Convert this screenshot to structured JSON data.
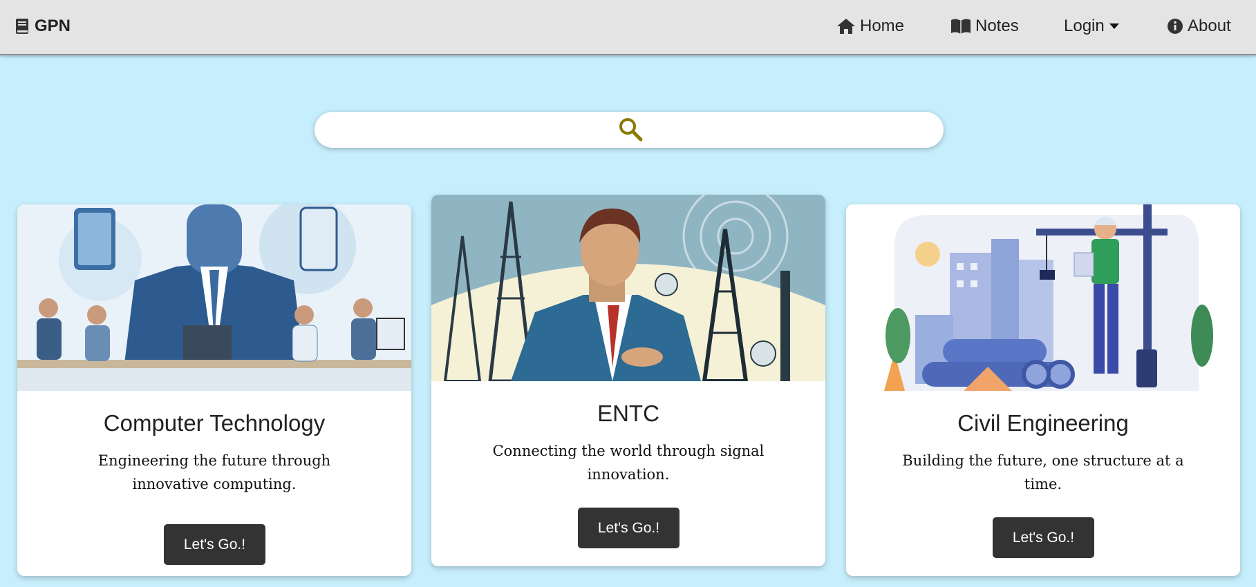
{
  "navbar": {
    "brand": "GPN",
    "links": {
      "home": "Home",
      "notes": "Notes",
      "login": "Login",
      "about": "About"
    }
  },
  "search": {
    "placeholder": "",
    "value": ""
  },
  "cards": [
    {
      "title": "Computer Technology",
      "description": "Engineering the future through innovative computing.",
      "button": "Let's Go.!"
    },
    {
      "title": "ENTC",
      "description": "Connecting the world through signal innovation.",
      "button": "Let's Go.!"
    },
    {
      "title": "Civil Engineering",
      "description": "Building the future, one structure at a time.",
      "button": "Let's Go.!"
    }
  ],
  "colors": {
    "page_bg": "#c7eefc",
    "navbar_bg": "#e4e4e4",
    "button_bg": "#333333",
    "search_icon": "#8a7a00"
  }
}
